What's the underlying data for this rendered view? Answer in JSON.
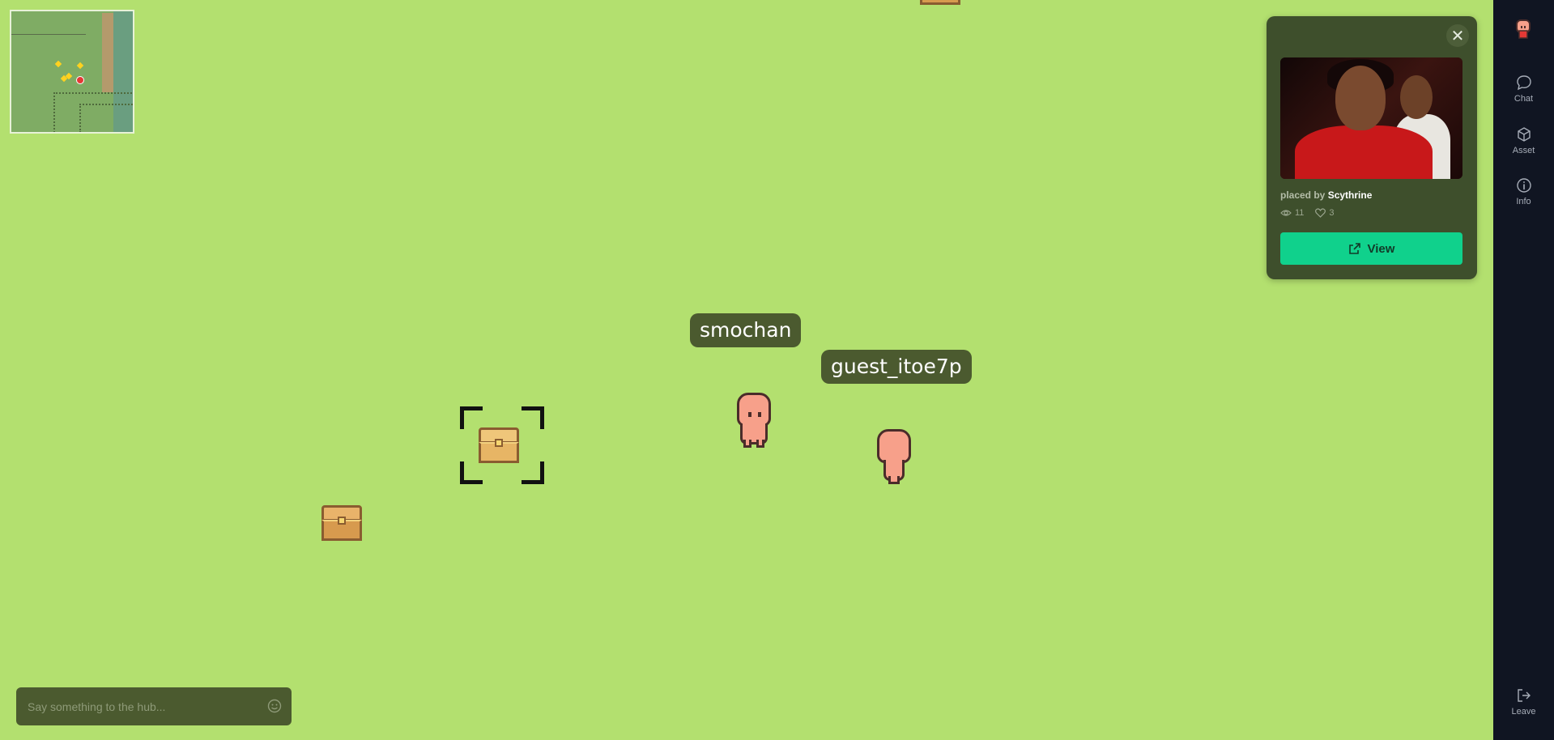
{
  "players": [
    {
      "name": "smochan"
    },
    {
      "name": "guest_itoe7p"
    }
  ],
  "asset_popup": {
    "placed_by_label": "placed by",
    "placed_by_user": "Scythrine",
    "views": "11",
    "likes": "3",
    "view_button": "View",
    "close_glyph": "✕",
    "icons": [
      "close-icon",
      "eye-icon",
      "heart-icon",
      "external-link-icon"
    ],
    "button_color": "#10d18c"
  },
  "sidebar": {
    "items": [
      {
        "label": "Chat",
        "icon": "chat-bubble-icon"
      },
      {
        "label": "Asset",
        "icon": "cube-icon"
      },
      {
        "label": "Info",
        "icon": "info-icon"
      },
      {
        "label": "Leave",
        "icon": "logout-icon"
      }
    ]
  },
  "chat": {
    "placeholder": "Say something to the hub...",
    "icon": "emoji-icon"
  },
  "colors": {
    "grass": "#b3e06f",
    "nametag_bg": "#4b5a2f",
    "sidebar_bg": "#101522"
  }
}
